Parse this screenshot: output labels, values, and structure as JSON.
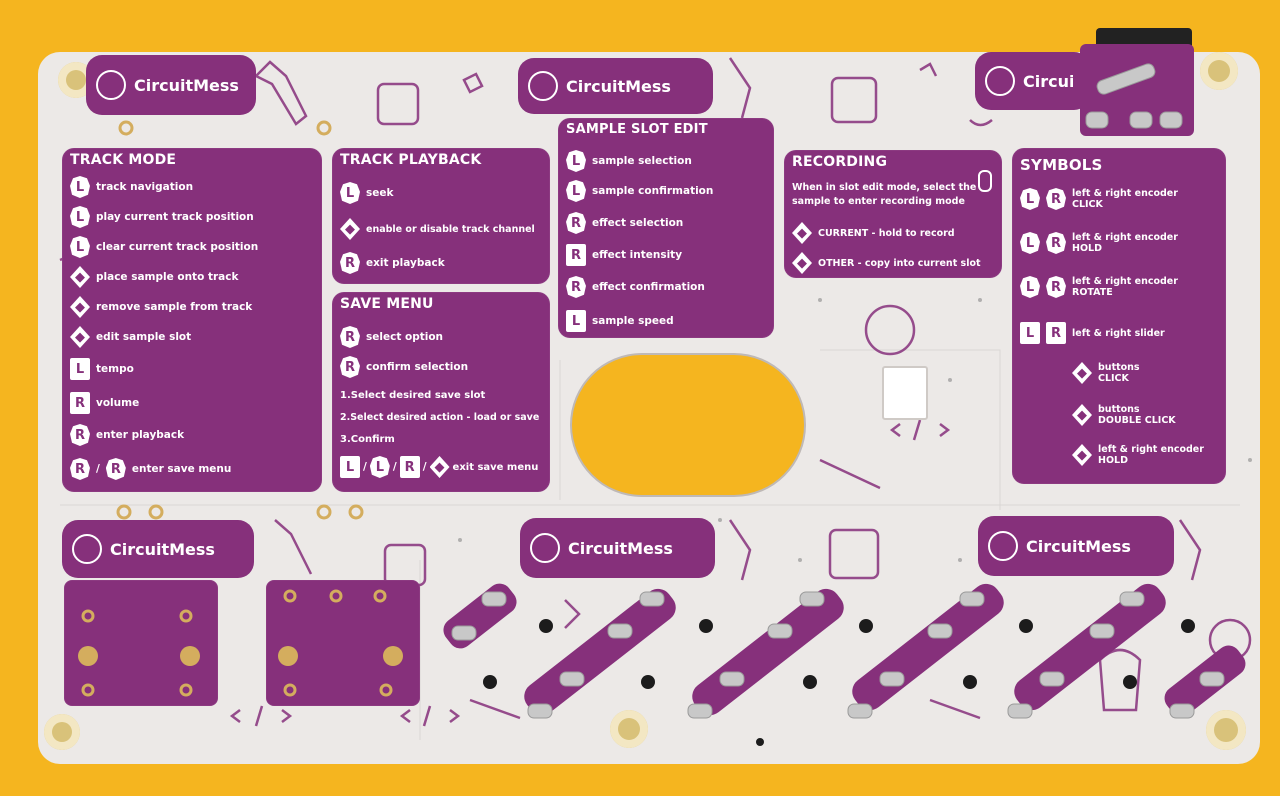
{
  "brand": "CircuitMess",
  "track_mode": {
    "title": "TRACK MODE",
    "items": [
      {
        "sym": "L",
        "label": "track navigation"
      },
      {
        "sym": "L",
        "label": "play current track position"
      },
      {
        "sym": "L",
        "label": "clear current track position"
      },
      {
        "sym": "◆",
        "label": "place sample onto track"
      },
      {
        "sym": "◆",
        "label": "remove sample from track"
      },
      {
        "sym": "◆",
        "label": "edit sample slot"
      },
      {
        "sym": "L",
        "label": "tempo"
      },
      {
        "sym": "R",
        "label": "volume"
      },
      {
        "sym": "R",
        "label": "enter playback"
      },
      {
        "sym": "R",
        "label": "enter save menu"
      }
    ]
  },
  "track_playback": {
    "title": "TRACK PLAYBACK",
    "items": [
      {
        "sym": "L",
        "label": "seek"
      },
      {
        "sym": "◆",
        "label": "enable or disable track channel"
      },
      {
        "sym": "R",
        "label": "exit playback"
      }
    ]
  },
  "save_menu": {
    "title": "SAVE MENU",
    "items": [
      {
        "sym": "R",
        "label": "select option"
      },
      {
        "sym": "R",
        "label": "confirm selection"
      }
    ],
    "steps": [
      "1.Select desired save slot",
      "2.Select desired action - load or save",
      "3.Confirm"
    ],
    "exit_label": "exit save menu",
    "exit_syms": [
      "L",
      "L",
      "R",
      "◆"
    ]
  },
  "sample_slot_edit": {
    "title": "SAMPLE SLOT EDIT",
    "items": [
      {
        "sym": "L",
        "label": "sample selection"
      },
      {
        "sym": "L",
        "label": "sample confirmation"
      },
      {
        "sym": "R",
        "label": "effect selection"
      },
      {
        "sym": "R",
        "label": "effect intensity"
      },
      {
        "sym": "R",
        "label": "effect confirmation"
      },
      {
        "sym": "L",
        "label": "sample speed"
      }
    ]
  },
  "recording": {
    "title": "RECORDING",
    "desc1": "When in slot edit mode, select the",
    "desc2": "sample to enter recording mode",
    "items": [
      {
        "sym": "◆",
        "label": "CURRENT - hold to record"
      },
      {
        "sym": "◆",
        "label": "OTHER - copy into current slot"
      }
    ]
  },
  "symbols": {
    "title": "SYMBOLS",
    "items": [
      {
        "syms": [
          "L",
          "R"
        ],
        "line1": "left & right encoder",
        "line2": "CLICK"
      },
      {
        "syms": [
          "L",
          "R"
        ],
        "line1": "left & right encoder",
        "line2": "HOLD"
      },
      {
        "syms": [
          "L",
          "R"
        ],
        "line1": "left & right encoder",
        "line2": "ROTATE"
      },
      {
        "syms": [
          "L",
          "R"
        ],
        "line1": "left & right slider",
        "line2": ""
      },
      {
        "syms": [
          "◆"
        ],
        "line1": "buttons",
        "line2": "CLICK"
      },
      {
        "syms": [
          "◆"
        ],
        "line1": "buttons",
        "line2": "DOUBLE CLICK"
      },
      {
        "syms": [
          "◆"
        ],
        "line1": "left & right encoder",
        "line2": "HOLD"
      }
    ]
  },
  "colors": {
    "background": "#f5b51f",
    "board": "#ece9e7",
    "silkscreen": "#86307b",
    "pad": "#c8c8c8"
  }
}
